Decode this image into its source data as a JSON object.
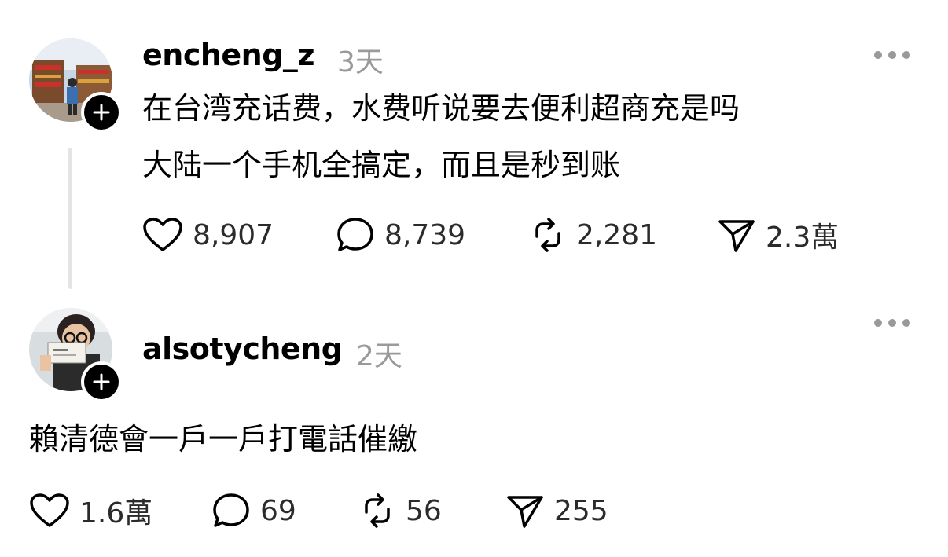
{
  "posts": [
    {
      "username": "encheng_z",
      "time": "3天",
      "body": [
        "在台湾充话费，水费听说要去便利超商充是吗",
        "大陆一个手机全搞定，而且是秒到账"
      ],
      "likes": "8,907",
      "replies": "8,739",
      "reposts": "2,281",
      "shares": "2.3萬"
    },
    {
      "username": "alsotycheng",
      "time": "2天",
      "body": [
        "賴清德會一戶一戶打電話催繳"
      ],
      "likes": "1.6萬",
      "replies": "69",
      "reposts": "56",
      "shares": "255"
    }
  ],
  "icons": {
    "like": "heart-icon",
    "reply": "comment-bubble-icon",
    "repost": "repost-icon",
    "share": "send-icon",
    "more": "more-options-icon",
    "follow": "plus-icon"
  }
}
